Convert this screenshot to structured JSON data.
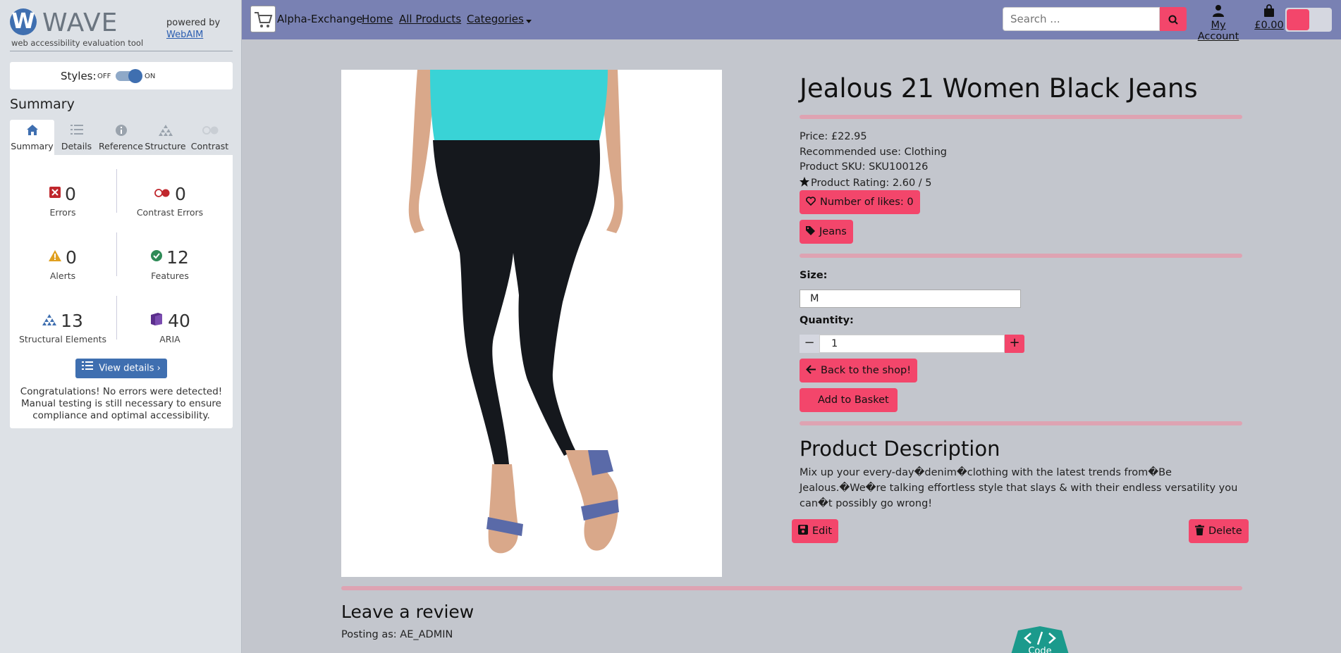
{
  "wave": {
    "logo_letter": "W",
    "wordmark": "WAVE",
    "tagline": "web accessibility evaluation tool",
    "powered_by": "powered by",
    "webaim_link": "WebAIM",
    "styles_label": "Styles:",
    "styles_off": "OFF",
    "styles_on": "ON",
    "summary_title": "Summary",
    "tabs": [
      {
        "label": "Summary",
        "icon": "home-icon"
      },
      {
        "label": "Details",
        "icon": "list-icon"
      },
      {
        "label": "Reference",
        "icon": "info-icon"
      },
      {
        "label": "Structure",
        "icon": "structure-icon"
      },
      {
        "label": "Contrast",
        "icon": "contrast-icon"
      }
    ],
    "stats": {
      "errors": {
        "count": "0",
        "label": "Errors"
      },
      "contrast_errors": {
        "count": "0",
        "label": "Contrast Errors"
      },
      "alerts": {
        "count": "0",
        "label": "Alerts"
      },
      "features": {
        "count": "12",
        "label": "Features"
      },
      "structural": {
        "count": "13",
        "label": "Structural Elements"
      },
      "aria": {
        "count": "40",
        "label": "ARIA"
      }
    },
    "view_details": "View details ›",
    "congrats": "Congratulations! No errors were detected! Manual testing is still necessary to ensure compliance and optimal accessibility."
  },
  "nav": {
    "brand": "Alpha-Exchange",
    "home": "Home",
    "all_products": "All Products",
    "categories": "Categories",
    "search_placeholder": "Search ...",
    "my_account": "My Account",
    "basket_total": "£0.00"
  },
  "product": {
    "title": "Jealous 21 Women Black Jeans",
    "price": "Price: £22.95",
    "recommended_use": "Recommended use: Clothing",
    "sku": "Product SKU: SKU100126",
    "rating": "Product Rating: 2.60 / 5",
    "likes": "Number of likes: 0",
    "tag": "Jeans",
    "size_label": "Size:",
    "size_value": "M",
    "quantity_label": "Quantity:",
    "quantity_value": "1",
    "back_button": "Back to the shop!",
    "add_button": "Add to Basket",
    "desc_title": "Product Description",
    "desc_text": "Mix up your every-day�denim�clothing with the latest trends from�Be Jealous.�We�re talking effortless style that slays & with their endless versatility you can�t possibly go wrong!",
    "edit": "Edit",
    "delete": "Delete"
  },
  "review": {
    "title": "Leave a review",
    "posting_as": "Posting as: AE_ADMIN"
  },
  "code_badge": "Code",
  "colors": {
    "accent_pink": "#f3466b",
    "navbar": "#7981b3",
    "wave_blue": "#3f6fb0",
    "divider": "#dea3b2"
  }
}
